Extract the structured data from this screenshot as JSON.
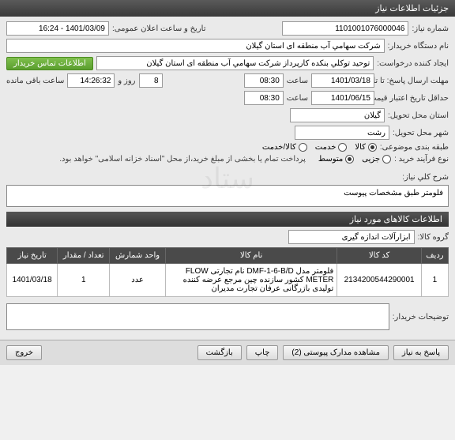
{
  "title": "جزئیات اطلاعات نیاز",
  "labels": {
    "needNo": "شماره نیاز:",
    "buyerOrg": "نام دستگاه خریدار:",
    "requester": "ایجاد کننده درخواست:",
    "deadlineSend": "مهلت ارسال پاسخ: تا تاریخ:",
    "minValidDate": "حداقل تاریخ اعتبار قیمت: تا تاریخ:",
    "deliveryProvince": "استان محل تحویل:",
    "deliveryCity": "شهر محل تحویل:",
    "subjectClass": "طبقه بندی موضوعی:",
    "purchaseType": "نوع فرآیند خرید :",
    "announceDate": "تاریخ و ساعت اعلان عمومی:",
    "hour": "ساعت",
    "dayAnd": "روز و",
    "remaining": "ساعت باقی مانده",
    "generalDesc": "شرح کلي نیاز:",
    "itemsInfo": "اطلاعات کالاهای مورد نیاز",
    "goodsGroup": "گروه کالا:",
    "buyerNotes": "توضیحات خریدار:",
    "contactBtn": "اطلاعات تماس خریدار",
    "paymentNote": "پرداخت تمام یا بخشی از مبلغ خرید،از محل \"اسناد خزانه اسلامی\" خواهد بود."
  },
  "values": {
    "needNo": "1101001076000046",
    "buyerOrg": "شرکت سهامي آب منطقه ای استان گیلان",
    "requester": "توحید توکلي بنکده کارپرداز شرکت سهامي آب منطقه ای استان گیلان",
    "deadlineDate": "1401/03/18",
    "deadlineTime": "08:30",
    "remainDays": "8",
    "remainTime": "14:26:32",
    "minValidDate": "1401/06/15",
    "minValidTime": "08:30",
    "province": "گیلان",
    "city": "رشت",
    "announce": "1401/03/09 - 16:24",
    "goodsGroup": "ابزارآلات اندازه گیری",
    "generalDesc": "فلومتر طبق مشخصات پیوست"
  },
  "subjectOptions": [
    {
      "label": "کالا",
      "selected": true
    },
    {
      "label": "خدمت",
      "selected": false
    },
    {
      "label": "کالا/خدمت",
      "selected": false
    }
  ],
  "purchaseOptions": [
    {
      "label": "جزیی",
      "selected": false
    },
    {
      "label": "متوسط",
      "selected": true
    }
  ],
  "table": {
    "headers": [
      "ردیف",
      "کد کالا",
      "نام کالا",
      "واحد شمارش",
      "تعداد / مقدار",
      "تاریخ نیاز"
    ],
    "rows": [
      {
        "idx": "1",
        "code": "2134200544290001",
        "name": "فلومتر مدل DMF-1-6-B/D نام تجارتی FLOW METER کشور سازنده چین مرجع عرضه کننده تولیدی بازرگانی عرفان تجارت مدیران",
        "unit": "عدد",
        "qty": "1",
        "date": "1401/03/18"
      }
    ]
  },
  "footerButtons": {
    "reply": "پاسخ به نیاز",
    "attachments": "مشاهده مدارک پیوستی (2)",
    "print": "چاپ",
    "back": "بازگشت",
    "exit": "خروج"
  },
  "watermark": "ستاد"
}
